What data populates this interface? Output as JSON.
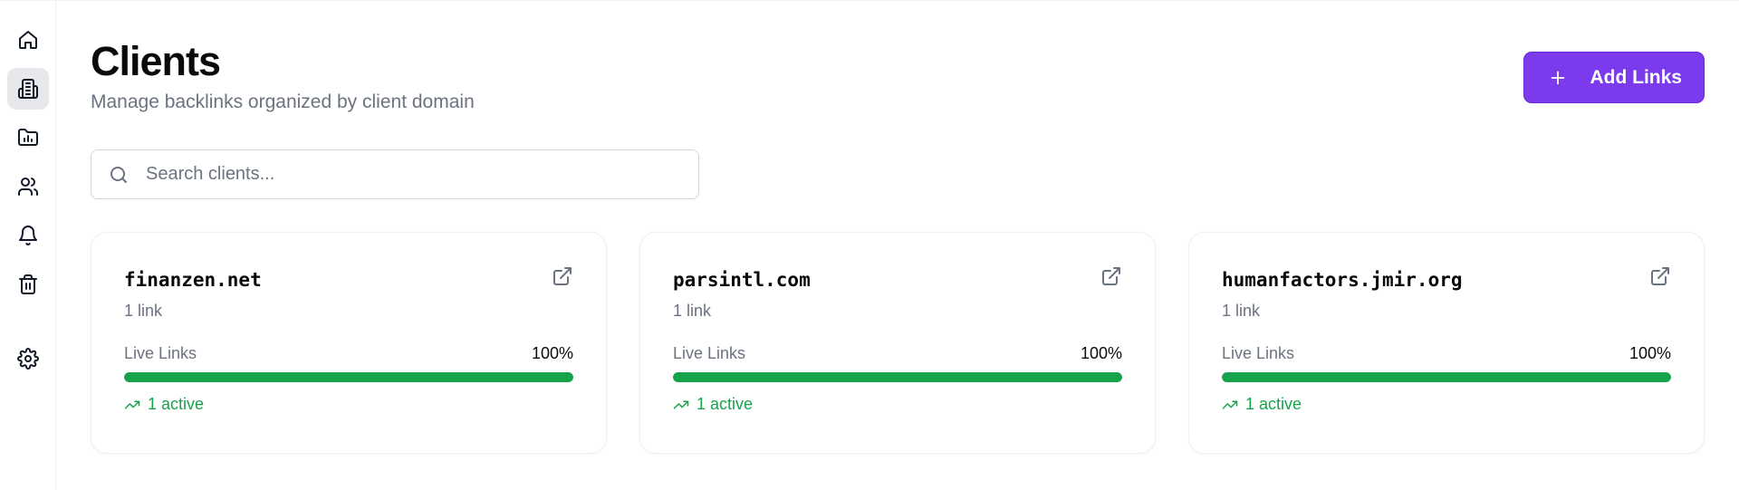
{
  "header": {
    "title": "Clients",
    "subtitle": "Manage backlinks organized by client domain",
    "add_label": "Add Links"
  },
  "search": {
    "placeholder": "Search clients...",
    "value": ""
  },
  "sidebar": {
    "items": [
      {
        "name": "home",
        "icon": "home-icon",
        "active": false
      },
      {
        "name": "clients",
        "icon": "building-icon",
        "active": true
      },
      {
        "name": "reports",
        "icon": "folder-chart-icon",
        "active": false
      },
      {
        "name": "users",
        "icon": "users-icon",
        "active": false
      },
      {
        "name": "notifications",
        "icon": "bell-icon",
        "active": false
      },
      {
        "name": "trash",
        "icon": "trash-icon",
        "active": false
      },
      {
        "name": "settings",
        "icon": "gear-icon",
        "active": false
      }
    ]
  },
  "clients": [
    {
      "domain": "finanzen.net",
      "count": "1 link",
      "live_label": "Live Links",
      "percent": "100%",
      "progress": 1.0,
      "active": "1 active"
    },
    {
      "domain": "parsintl.com",
      "count": "1 link",
      "live_label": "Live Links",
      "percent": "100%",
      "progress": 1.0,
      "active": "1 active"
    },
    {
      "domain": "humanfactors.jmir.org",
      "count": "1 link",
      "live_label": "Live Links",
      "percent": "100%",
      "progress": 1.0,
      "active": "1 active"
    }
  ],
  "colors": {
    "accent": "#7c3aed",
    "success": "#16a34a",
    "muted": "#6b7280"
  }
}
